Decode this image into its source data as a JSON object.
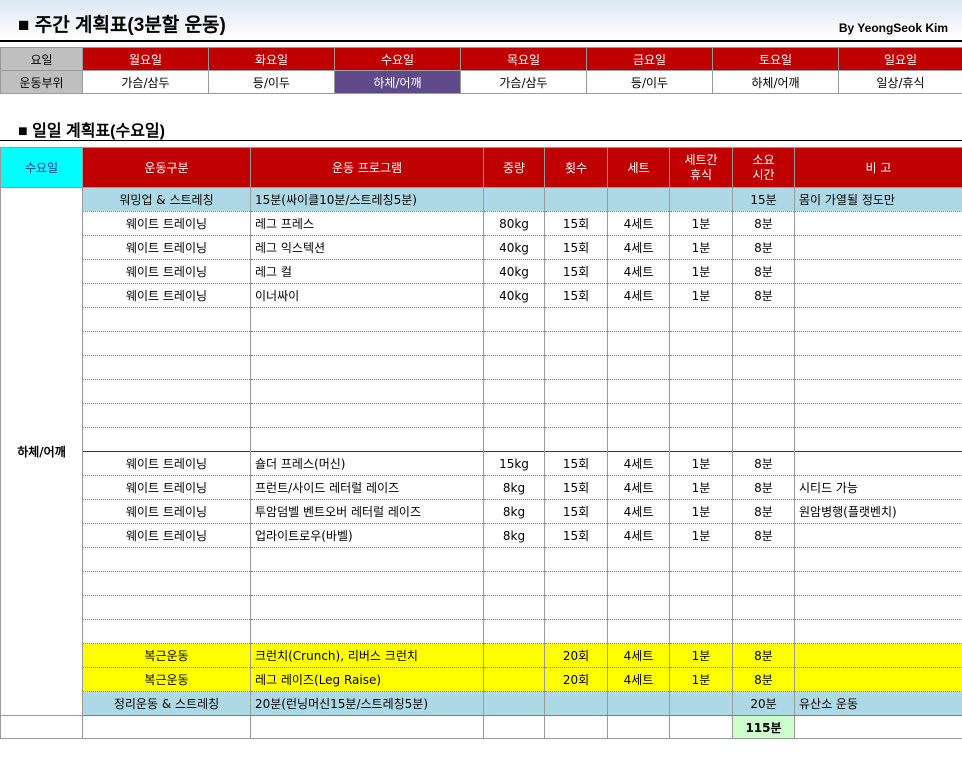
{
  "header": {
    "title": "■ 주간 계획표(3분할 운동)",
    "author": "By YeongSeok Kim"
  },
  "weekly": {
    "row_label_day": "요일",
    "row_label_part": "운동부위",
    "days": [
      "월요일",
      "화요일",
      "수요일",
      "목요일",
      "금요일",
      "토요일",
      "일요일"
    ],
    "parts": [
      "가슴/삼두",
      "등/이두",
      "하체/어깨",
      "가슴/삼두",
      "등/이두",
      "하체/어깨",
      "일상/휴식"
    ],
    "selected_index": 2,
    "colors": {
      "header_bg": "#c00000",
      "selected_bg": "#5f4b8b",
      "label_bg": "#bfbfbf"
    }
  },
  "daily": {
    "title": "■ 일일 계획표(수요일)",
    "headers": {
      "day": "수요일",
      "category": "운동구분",
      "program": "운동 프로그램",
      "weight": "중량",
      "reps": "횟수",
      "sets": "세트",
      "rest_l1": "세트간",
      "rest_l2": "휴식",
      "time_l1": "소요",
      "time_l2": "시간",
      "note": "비  고"
    },
    "day_part": "하체/어깨",
    "rows": [
      {
        "style": "blue",
        "category": "워밍업 & 스트레칭",
        "program": "15분(싸이클10분/스트레칭5분)",
        "weight": "",
        "reps": "",
        "sets": "",
        "rest": "",
        "time": "15분",
        "note": "몸이 가열될 정도만"
      },
      {
        "style": "",
        "category": "웨이트 트레이닝",
        "program": "레그 프레스",
        "weight": "80kg",
        "reps": "15회",
        "sets": "4세트",
        "rest": "1분",
        "time": "8분",
        "note": ""
      },
      {
        "style": "",
        "category": "웨이트 트레이닝",
        "program": "레그 익스텍션",
        "weight": "40kg",
        "reps": "15회",
        "sets": "4세트",
        "rest": "1분",
        "time": "8분",
        "note": ""
      },
      {
        "style": "",
        "category": "웨이트 트레이닝",
        "program": "레그 컬",
        "weight": "40kg",
        "reps": "15회",
        "sets": "4세트",
        "rest": "1분",
        "time": "8분",
        "note": ""
      },
      {
        "style": "",
        "category": "웨이트 트레이닝",
        "program": "이너싸이",
        "weight": "40kg",
        "reps": "15회",
        "sets": "4세트",
        "rest": "1분",
        "time": "8분",
        "note": ""
      },
      {
        "style": "",
        "category": "",
        "program": "",
        "weight": "",
        "reps": "",
        "sets": "",
        "rest": "",
        "time": "",
        "note": ""
      },
      {
        "style": "",
        "category": "",
        "program": "",
        "weight": "",
        "reps": "",
        "sets": "",
        "rest": "",
        "time": "",
        "note": ""
      },
      {
        "style": "",
        "category": "",
        "program": "",
        "weight": "",
        "reps": "",
        "sets": "",
        "rest": "",
        "time": "",
        "note": ""
      },
      {
        "style": "",
        "category": "",
        "program": "",
        "weight": "",
        "reps": "",
        "sets": "",
        "rest": "",
        "time": "",
        "note": ""
      },
      {
        "style": "",
        "category": "",
        "program": "",
        "weight": "",
        "reps": "",
        "sets": "",
        "rest": "",
        "time": "",
        "note": ""
      },
      {
        "style": "",
        "category": "",
        "program": "",
        "weight": "",
        "reps": "",
        "sets": "",
        "rest": "",
        "time": "",
        "note": ""
      },
      {
        "style": "sep",
        "category": "웨이트 트레이닝",
        "program": "숄더 프레스(머신)",
        "weight": "15kg",
        "reps": "15회",
        "sets": "4세트",
        "rest": "1분",
        "time": "8분",
        "note": ""
      },
      {
        "style": "",
        "category": "웨이트 트레이닝",
        "program": "프런트/사이드 레터럴 레이즈",
        "weight": "8kg",
        "reps": "15회",
        "sets": "4세트",
        "rest": "1분",
        "time": "8분",
        "note": "시티드 가능"
      },
      {
        "style": "",
        "category": "웨이트 트레이닝",
        "program": "투암덤벨 벤트오버 레터럴 레이즈",
        "weight": "8kg",
        "reps": "15회",
        "sets": "4세트",
        "rest": "1분",
        "time": "8분",
        "note": "원암병행(플랫벤치)"
      },
      {
        "style": "",
        "category": "웨이트 트레이닝",
        "program": "업라이트로우(바벨)",
        "weight": "8kg",
        "reps": "15회",
        "sets": "4세트",
        "rest": "1분",
        "time": "8분",
        "note": ""
      },
      {
        "style": "",
        "category": "",
        "program": "",
        "weight": "",
        "reps": "",
        "sets": "",
        "rest": "",
        "time": "",
        "note": ""
      },
      {
        "style": "",
        "category": "",
        "program": "",
        "weight": "",
        "reps": "",
        "sets": "",
        "rest": "",
        "time": "",
        "note": ""
      },
      {
        "style": "",
        "category": "",
        "program": "",
        "weight": "",
        "reps": "",
        "sets": "",
        "rest": "",
        "time": "",
        "note": ""
      },
      {
        "style": "",
        "category": "",
        "program": "",
        "weight": "",
        "reps": "",
        "sets": "",
        "rest": "",
        "time": "",
        "note": ""
      },
      {
        "style": "yellow",
        "category": "복근운동",
        "program": "크런치(Crunch), 리버스 크런치",
        "weight": "",
        "reps": "20회",
        "sets": "4세트",
        "rest": "1분",
        "time": "8분",
        "note": ""
      },
      {
        "style": "yellow",
        "category": "복근운동",
        "program": "레그 레이즈(Leg Raise)",
        "weight": "",
        "reps": "20회",
        "sets": "4세트",
        "rest": "1분",
        "time": "8분",
        "note": ""
      },
      {
        "style": "blue",
        "category": "정리운동 & 스트레칭",
        "program": "20분(런닝머신15분/스트레칭5분)",
        "weight": "",
        "reps": "",
        "sets": "",
        "rest": "",
        "time": "20분",
        "note": "유산소 운동"
      }
    ],
    "total_time": "115분",
    "colors": {
      "blue_row": "#add8e6",
      "yellow_row": "#ffff00",
      "total_bg": "#ccffcc",
      "day_header_bg": "#00ffff"
    }
  }
}
